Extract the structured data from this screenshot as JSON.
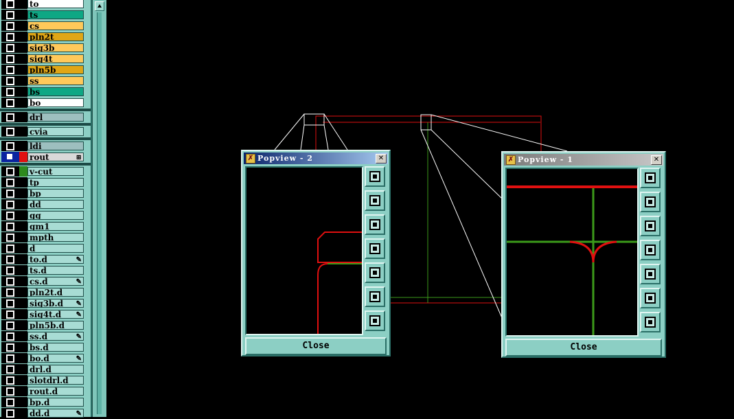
{
  "colors": {
    "background": "#000000",
    "panel": "#8ccfc4",
    "route_red": "#e01010",
    "route_green": "#3c9a1a",
    "outline_white": "#ffffff"
  },
  "layers": [
    {
      "label": "to",
      "color": "#ffffff"
    },
    {
      "label": "ts",
      "color": "#0ea784"
    },
    {
      "label": "cs",
      "color": "#ffc95a"
    },
    {
      "label": "pln2t",
      "color": "#e0a616"
    },
    {
      "label": "sig3b",
      "color": "#ffc95a"
    },
    {
      "label": "sig4t",
      "color": "#ffc95a"
    },
    {
      "label": "pln5b",
      "color": "#e0a616"
    },
    {
      "label": "ss",
      "color": "#ffc95a"
    },
    {
      "label": "bs",
      "color": "#0ea784"
    },
    {
      "label": "bo",
      "color": "#ffffff"
    }
  ],
  "layers_mid": [
    {
      "label": "drl",
      "color": "#9dbfbf"
    },
    {
      "label": "cvia",
      "color": "#a8dcd4"
    },
    {
      "label": "ldi",
      "color": "#9dbfbf"
    },
    {
      "label": "rout",
      "color": "#d9d9d9",
      "mark": "⊞"
    }
  ],
  "layers_drill": [
    {
      "label": "v-cut",
      "mark": ""
    },
    {
      "label": "tp",
      "mark": ""
    },
    {
      "label": "bp",
      "mark": ""
    },
    {
      "label": "dd",
      "mark": ""
    },
    {
      "label": "gg",
      "mark": ""
    },
    {
      "label": "gm1",
      "mark": ""
    },
    {
      "label": "mpth",
      "mark": ""
    },
    {
      "label": "d",
      "mark": ""
    },
    {
      "label": "to.d",
      "mark": "✎"
    },
    {
      "label": "ts.d",
      "mark": ""
    },
    {
      "label": "cs.d",
      "mark": "✎"
    },
    {
      "label": "pln2t.d",
      "mark": ""
    },
    {
      "label": "sig3b.d",
      "mark": "✎"
    },
    {
      "label": "sig4t.d",
      "mark": "✎"
    },
    {
      "label": "pln5b.d",
      "mark": ""
    },
    {
      "label": "ss.d",
      "mark": "✎"
    },
    {
      "label": "bs.d",
      "mark": ""
    },
    {
      "label": "bo.d",
      "mark": "✎"
    },
    {
      "label": "drl.d",
      "mark": ""
    },
    {
      "label": "slotdrl.d",
      "mark": ""
    },
    {
      "label": "rout.d",
      "mark": ""
    },
    {
      "label": "bp.d",
      "mark": ""
    },
    {
      "label": "dd.d",
      "mark": "✎"
    }
  ],
  "popview2": {
    "title": "Popview - 2",
    "close_label": "Close",
    "close_x": "✕"
  },
  "popview1": {
    "title": "Popview - 1",
    "close_label": "Close",
    "close_x": "✕"
  },
  "tools": [
    "zoom-fit-icon",
    "pan-up-icon",
    "pan-down-icon",
    "pan-left-icon",
    "pan-right-icon",
    "zoom-in-icon",
    "zoom-out-icon"
  ]
}
